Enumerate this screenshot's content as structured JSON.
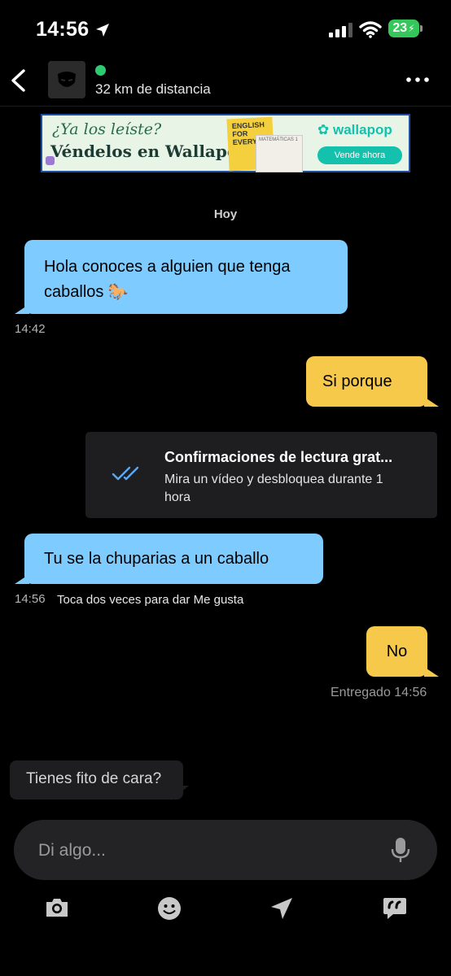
{
  "status_bar": {
    "time": "14:56",
    "battery": "23"
  },
  "header": {
    "distance": "32 km de distancia"
  },
  "ad": {
    "question": "¿Ya los leíste?",
    "tagline": "Véndelos en Wallapop.",
    "book1_text": "ENGLISH FOR EVERY",
    "book2_text": "MATEMÁTICAS 1",
    "brand": "wallapop",
    "cta": "Vende ahora"
  },
  "chat": {
    "date_label": "Hoy",
    "messages": [
      {
        "text": "Hola conoces a alguien que tenga caballos 🐎",
        "time": "14:42",
        "side": "in"
      },
      {
        "text": "Si porque",
        "side": "out"
      },
      {
        "text": "Tu se la chuparias a un caballo",
        "time": "14:56",
        "hint": "Toca dos veces para dar Me gusta",
        "side": "in"
      },
      {
        "text": "No",
        "side": "out",
        "status": "Entregado 14:56"
      }
    ],
    "read_receipts": {
      "title": "Confirmaciones de lectura grat...",
      "subtitle": "Mira un vídeo y desbloquea durante 1 hora"
    }
  },
  "suggestion": "Tienes fito de cara?",
  "composer": {
    "placeholder": "Di algo..."
  },
  "colors": {
    "incoming": "#7ecbff",
    "outgoing": "#f7c94a",
    "online": "#2ecc71"
  },
  "toolbar_icons": [
    "camera-icon",
    "emoji-icon",
    "location-arrow-icon",
    "quick-replies-icon"
  ]
}
